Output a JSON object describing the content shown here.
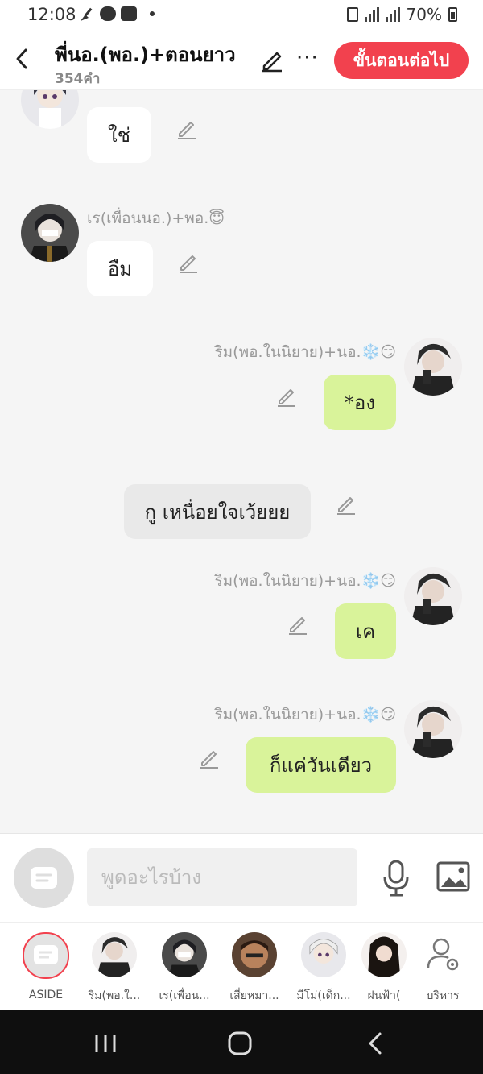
{
  "status_bar": {
    "time": "12:08",
    "battery": "70%"
  },
  "header": {
    "title": "พี่นอ.(พอ.)+ตอนยาว",
    "word_count": "354คำ",
    "next_button": "ขั้นตอนต่อไป"
  },
  "messages": [
    {
      "side": "left",
      "speaker": "",
      "text": "ใช่"
    },
    {
      "side": "left",
      "speaker": "เร(เพื่อนนอ.)+พอ.😇",
      "text": "อืม"
    },
    {
      "side": "right",
      "speaker": "ริม(พอ.ในนิยาย)+นอ.❄️😏",
      "text": "*อง"
    },
    {
      "side": "center",
      "speaker": "",
      "text": "กู เหนื่อยใจเว้ยยย"
    },
    {
      "side": "right",
      "speaker": "ริม(พอ.ในนิยาย)+นอ.❄️😏",
      "text": "เค"
    },
    {
      "side": "right",
      "speaker": "ริม(พอ.ในนิยาย)+นอ.❄️😏",
      "text": "ก็แค่วันเดียว"
    }
  ],
  "input": {
    "placeholder": "พูดอะไรบ้าง"
  },
  "characters": [
    {
      "name": "ASIDE"
    },
    {
      "name": "ริม(พอ.ใ..."
    },
    {
      "name": "เร(เพื่อน..."
    },
    {
      "name": "เสี่ยหมา..."
    },
    {
      "name": "มีโม่(เด็ก..."
    },
    {
      "name": "ฝนฟ้า("
    },
    {
      "name": "บริหาร"
    }
  ],
  "colors": {
    "accent": "#f2414e",
    "bubble_mine": "#d9f39a",
    "bubble_other": "#ffffff",
    "background": "#f5f5f5"
  }
}
